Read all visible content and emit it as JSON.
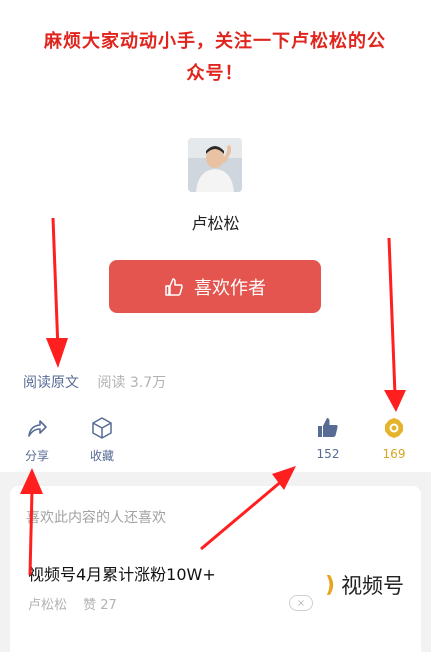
{
  "notice": {
    "line1": "麻烦大家动动小手，关注一下卢松松的公",
    "line2": "众号！"
  },
  "author": {
    "name": "卢松松",
    "like_button_label": "喜欢作者"
  },
  "meta": {
    "read_original": "阅读原文",
    "read_count": "阅读 3.7万"
  },
  "actions": {
    "share_label": "分享",
    "favorite_label": "收藏",
    "like_count": "152",
    "wow_count": "169"
  },
  "recommend": {
    "header": "喜欢此内容的人还喜欢",
    "title": "视频号4月累计涨粉10W+",
    "author": "卢松松",
    "likes": "赞 27",
    "dismiss_icon": "×",
    "thumb_text": "视频号"
  },
  "colors": {
    "notice_red": "#e0251f",
    "button_red": "#e4554f",
    "link_blue": "#576b95",
    "wow_gold": "#d9a522",
    "arrow_red": "#ff1f1f"
  }
}
